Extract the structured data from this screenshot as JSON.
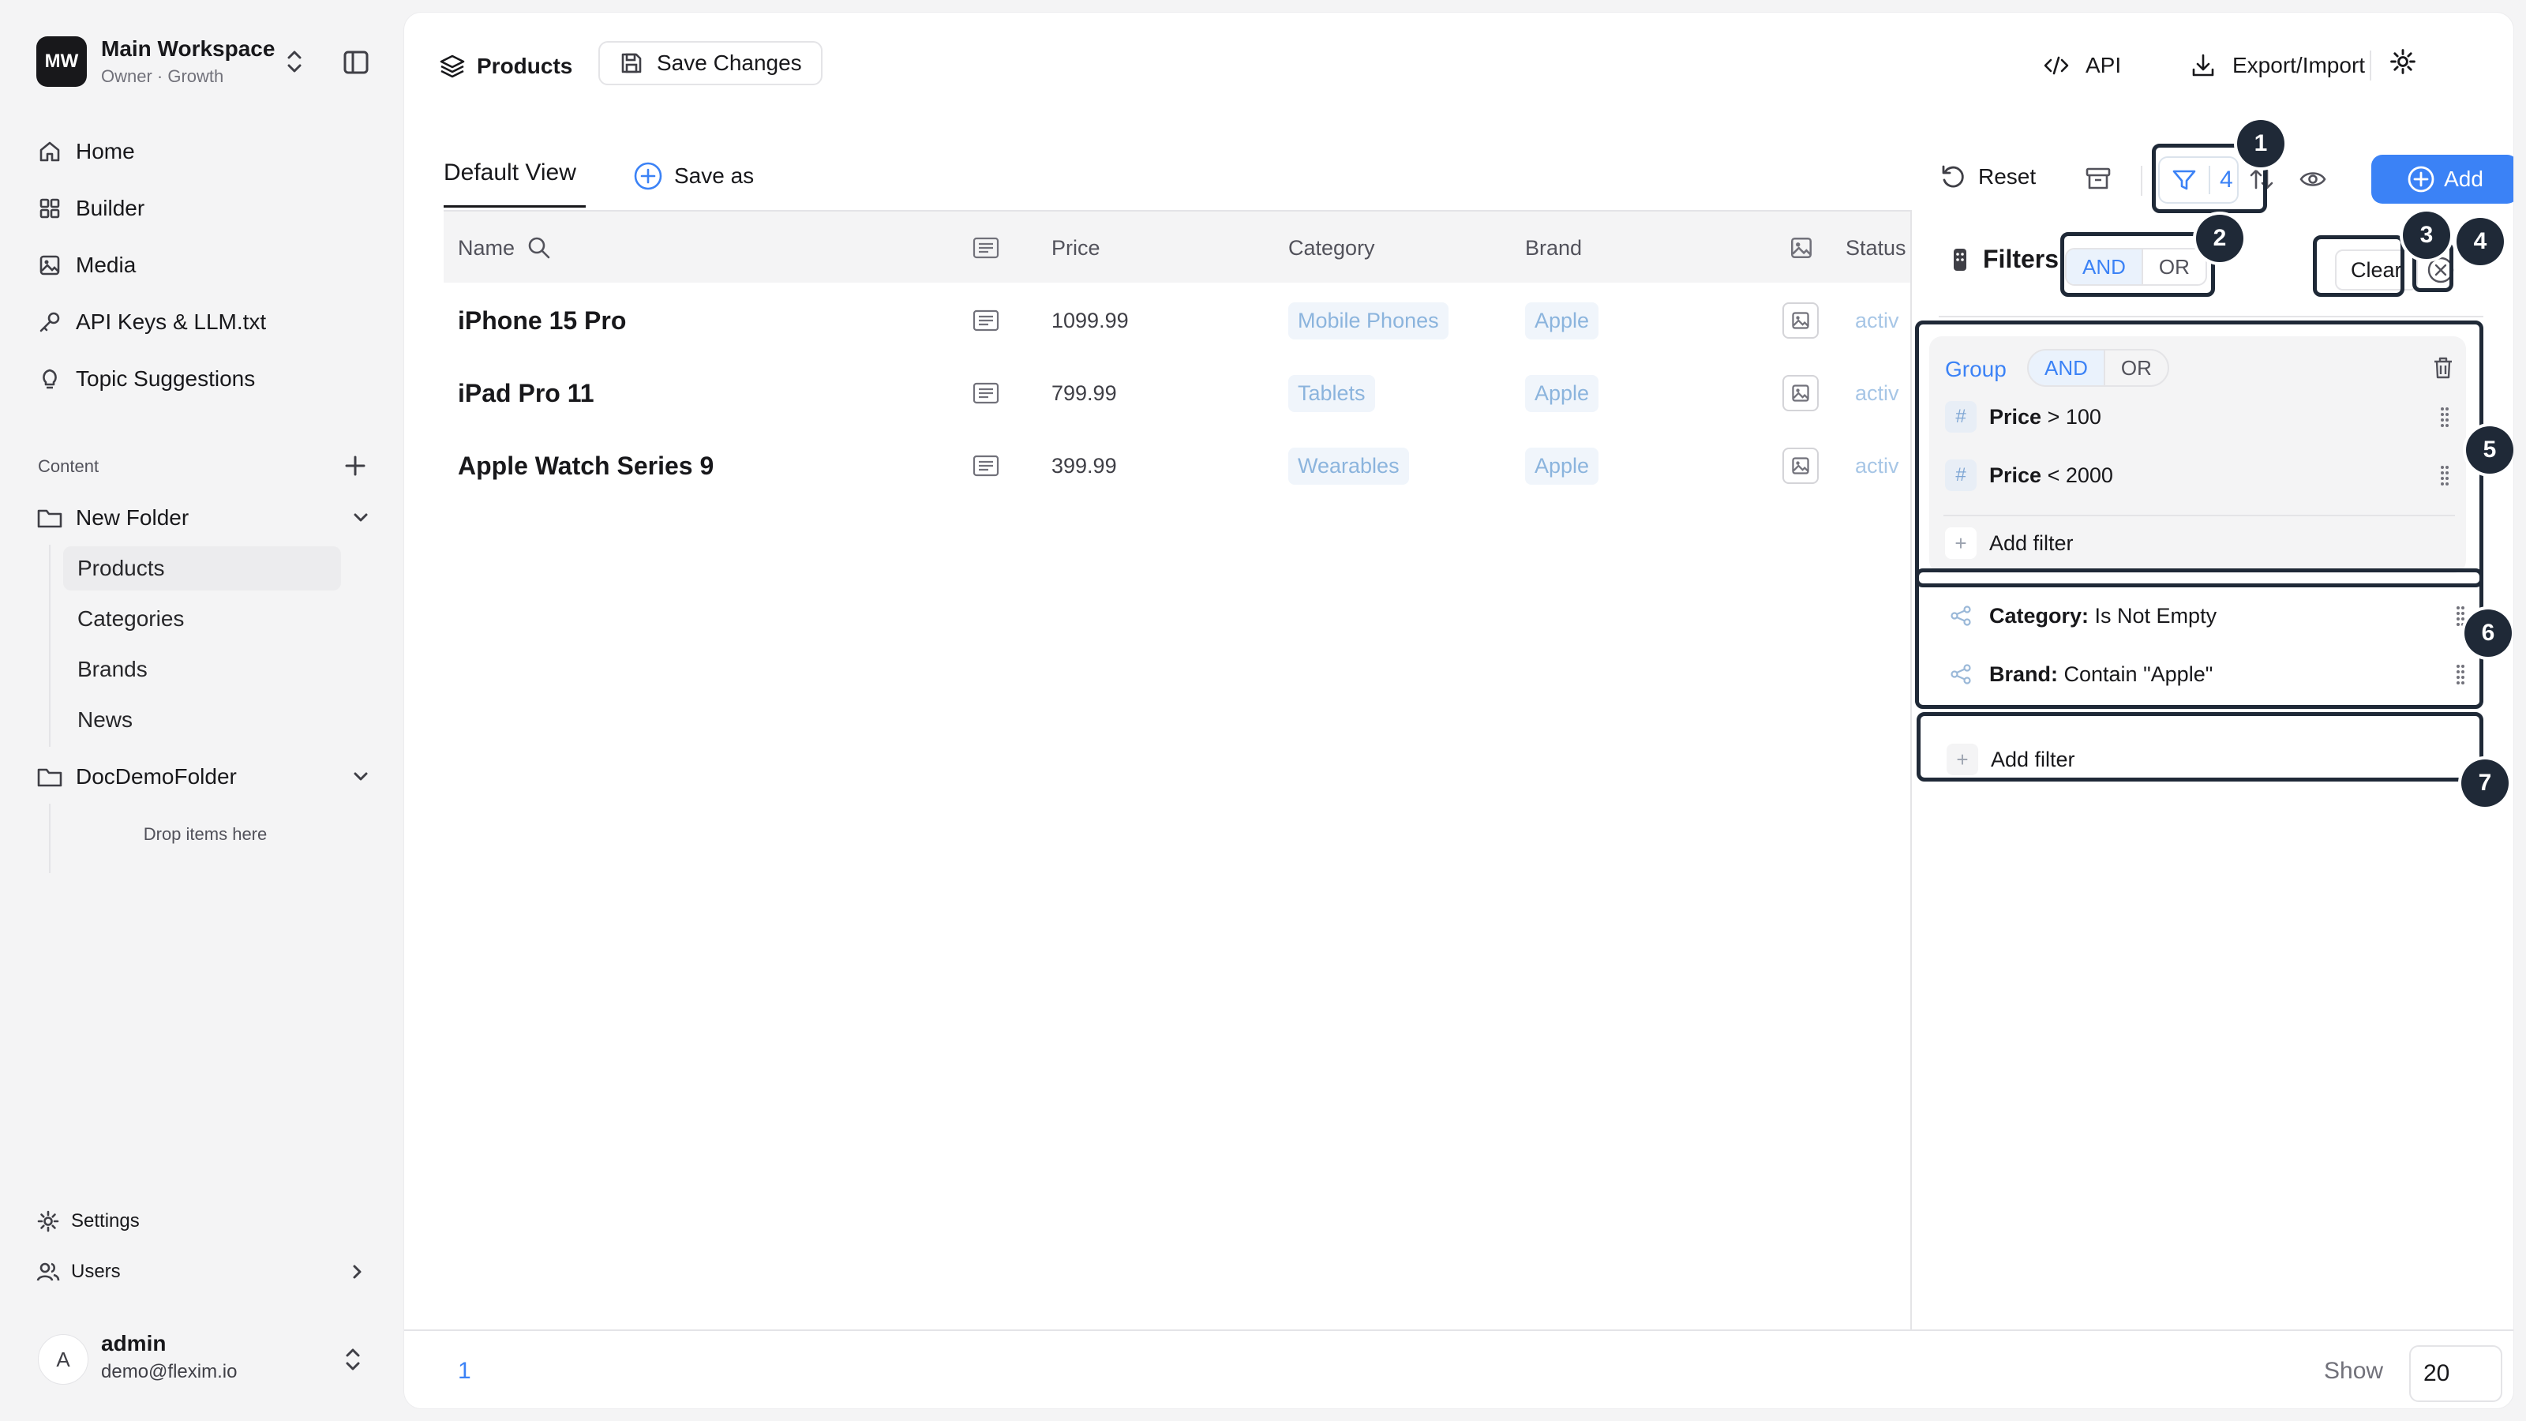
{
  "workspace": {
    "initials": "MW",
    "name": "Main Workspace",
    "subtitle": "Owner · Growth"
  },
  "nav": [
    {
      "label": "Home",
      "icon": "home-icon"
    },
    {
      "label": "Builder",
      "icon": "grid-icon"
    },
    {
      "label": "Media",
      "icon": "image-icon"
    },
    {
      "label": "API Keys & LLM.txt",
      "icon": "key-icon"
    },
    {
      "label": "Topic Suggestions",
      "icon": "lightbulb-icon"
    }
  ],
  "content_section": {
    "label": "Content"
  },
  "folders": [
    {
      "name": "New Folder",
      "items": [
        "Products",
        "Categories",
        "Brands",
        "News"
      ]
    },
    {
      "name": "DocDemoFolder",
      "empty_hint": "Drop items here"
    }
  ],
  "bottom_nav": {
    "settings": "Settings",
    "users": "Users"
  },
  "user": {
    "initial": "A",
    "name": "admin",
    "email": "demo@flexim.io"
  },
  "header": {
    "tab": "Products",
    "save": "Save Changes",
    "api": "API",
    "export": "Export/Import"
  },
  "views": {
    "current": "Default View",
    "save_as": "Save as"
  },
  "toolbar": {
    "reset": "Reset",
    "filter_count": "4",
    "add": "Add"
  },
  "table": {
    "columns": {
      "name": "Name",
      "price": "Price",
      "category": "Category",
      "brand": "Brand",
      "status": "Status"
    },
    "rows": [
      {
        "name": "iPhone 15 Pro",
        "price": "1099.99",
        "category": "Mobile Phones",
        "brand": "Apple",
        "status": "activ"
      },
      {
        "name": "iPad Pro 11",
        "price": "799.99",
        "category": "Tablets",
        "brand": "Apple",
        "status": "activ"
      },
      {
        "name": "Apple Watch Series 9",
        "price": "399.99",
        "category": "Wearables",
        "brand": "Apple",
        "status": "activ"
      }
    ]
  },
  "filters": {
    "title": "Filters",
    "and": "AND",
    "or": "OR",
    "clear": "Clear",
    "group": {
      "label": "Group",
      "and": "AND",
      "or": "OR",
      "rules": [
        {
          "field": "Price",
          "op": " > 100"
        },
        {
          "field": "Price",
          "op": " < 2000"
        }
      ],
      "add": "Add filter"
    },
    "rules": [
      {
        "field": "Category:",
        "op": " Is Not Empty"
      },
      {
        "field": "Brand:",
        "op": " Contain \"Apple\""
      }
    ],
    "add": "Add filter"
  },
  "callouts": [
    "1",
    "2",
    "3",
    "4",
    "5",
    "6",
    "7"
  ],
  "footer": {
    "page": "1",
    "show_label": "Show",
    "page_size": "20"
  },
  "colors": {
    "accent": "#3b82f6",
    "callout": "#1f2937",
    "tag_bg": "#f0f5fb"
  }
}
